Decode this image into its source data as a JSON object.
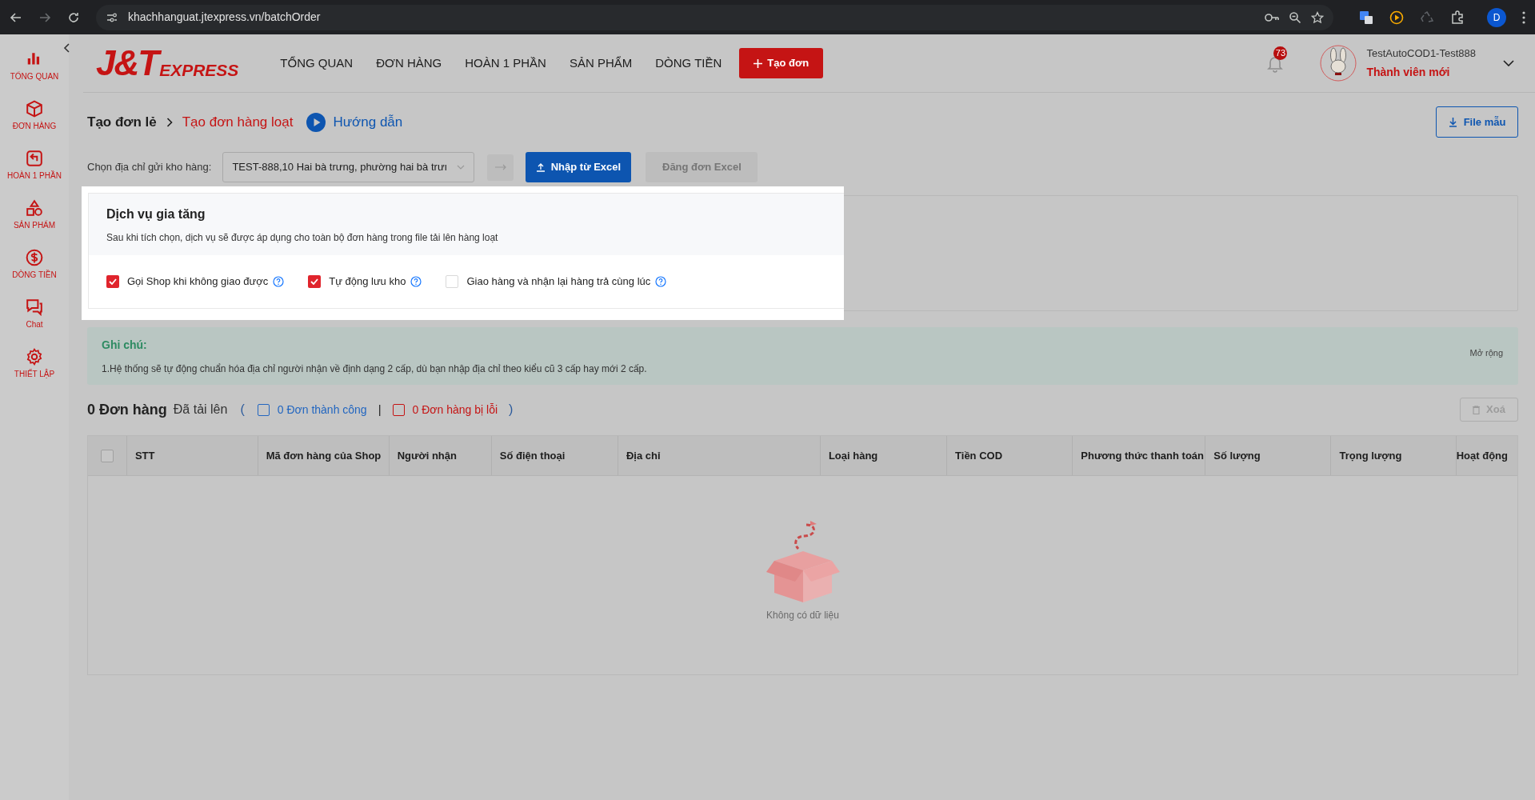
{
  "browser": {
    "url": "khachhanguat.jtexpress.vn/batchOrder",
    "profile": "D"
  },
  "sidebar": {
    "items": [
      {
        "kind": "chart",
        "label": "TỔNG QUAN"
      },
      {
        "kind": "box",
        "label": "ĐƠN HÀNG"
      },
      {
        "kind": "return",
        "label": "HOÀN 1 PHẦN"
      },
      {
        "kind": "shapes",
        "label": "SẢN PHẨM"
      },
      {
        "kind": "money",
        "label": "DÒNG TIỀN"
      },
      {
        "kind": "chat",
        "label": "Chat"
      },
      {
        "kind": "gear",
        "label": "THIẾT LẬP"
      }
    ]
  },
  "header": {
    "logo": {
      "mark": "J&T",
      "text": "EXPRESS"
    },
    "nav": [
      "TỔNG QUAN",
      "ĐƠN HÀNG",
      "HOÀN 1 PHẦN",
      "SẢN PHẨM",
      "DÒNG TIỀN"
    ],
    "create_button": "Tạo đơn",
    "notification_count": "73",
    "user_name": "TestAutoCOD1-Test888",
    "member_tier": "Thành viên mới"
  },
  "breadcrumb": {
    "items": [
      {
        "label": "Tạo đơn lẻ",
        "selected": false
      },
      {
        "label": "Tạo đơn hàng loạt",
        "selected": true
      }
    ],
    "guide": "Hướng dẫn"
  },
  "file_template_button": "File mẫu",
  "warehouse": {
    "label": "Chọn địa chỉ gửi kho hàng:",
    "value": "TEST-888,10 Hai bà trưng, phường hai bà trưı"
  },
  "import_button": {
    "label": "Nhập từ Excel",
    "disabled": false
  },
  "upload_button": {
    "label": "Đăng đơn Excel",
    "disabled": true
  },
  "value_added_services": {
    "title": "Dịch vụ gia tăng",
    "subtitle": "Sau khi tích chọn, dịch vụ sẽ được áp dụng cho toàn bộ đơn hàng trong file tải lên hàng loạt",
    "options": [
      {
        "label": "Gọi Shop khi không giao được",
        "checked": true
      },
      {
        "label": "Tự động lưu kho",
        "checked": true
      },
      {
        "label": "Giao hàng và nhận lại hàng trả cùng lúc",
        "checked": false
      }
    ]
  },
  "note": {
    "title": "Ghi chú:",
    "text": "1.Hệ thống sẽ tự động chuẩn hóa địa chỉ người nhận về định dạng 2 cấp, dù bạn nhập địa chỉ theo kiểu cũ 3 cấp hay mới 2 cấp.",
    "expand": "Mở rộng"
  },
  "summary": {
    "count": "0 Đơn hàng",
    "uploaded": "Đã tải lên",
    "open": "(",
    "success": "0 Đơn thành công",
    "success_checked": false,
    "separator": "|",
    "failed": "0 Đơn hàng bị lỗi",
    "failed_checked": false,
    "close": ")"
  },
  "delete_button": "Xoá",
  "table": {
    "select_all_checked": false,
    "columns": [
      "STT",
      "Mã đơn hàng của Shop",
      "Người nhận",
      "Số điện thoại",
      "Địa chỉ",
      "Loại hàng",
      "Tiền COD",
      "Phương thức thanh toán",
      "Số lượng",
      "Trọng lượng",
      "Hoạt động"
    ],
    "empty_text": "Không có dữ liệu"
  }
}
